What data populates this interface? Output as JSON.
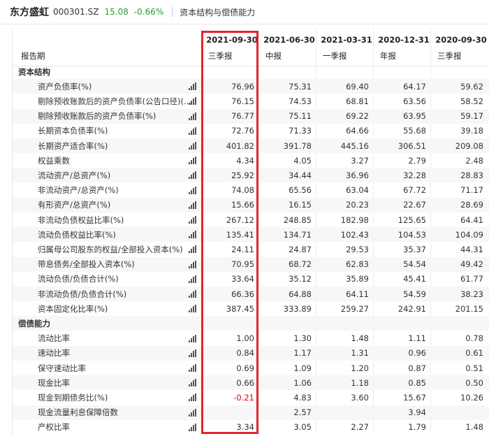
{
  "header": {
    "stock_name": "东方盛虹",
    "stock_code": "000301.SZ",
    "price": "15.08",
    "change": "-0.66%",
    "section": "资本结构与偿债能力"
  },
  "table": {
    "row_header_label": "报告期",
    "columns": [
      {
        "date": "2021-09-30",
        "type": "三季报"
      },
      {
        "date": "2021-06-30",
        "type": "中报"
      },
      {
        "date": "2021-03-31",
        "type": "一季报"
      },
      {
        "date": "2020-12-31",
        "type": "年报"
      },
      {
        "date": "2020-09-30",
        "type": "三季报"
      }
    ],
    "rows": [
      {
        "label": "资本结构",
        "section": true,
        "values": [
          "",
          "",
          "",
          "",
          ""
        ]
      },
      {
        "label": "资产负债率(%)",
        "values": [
          "76.96",
          "75.31",
          "69.40",
          "64.17",
          "59.62"
        ]
      },
      {
        "label": "剔除预收账款后的资产负债率(公告口径)(...",
        "values": [
          "76.15",
          "74.53",
          "68.81",
          "63.56",
          "58.52"
        ]
      },
      {
        "label": "剔除预收账款后的资产负债率(%)",
        "values": [
          "76.77",
          "75.11",
          "69.22",
          "63.95",
          "59.17"
        ]
      },
      {
        "label": "长期资本负债率(%)",
        "values": [
          "72.76",
          "71.33",
          "64.66",
          "55.68",
          "39.18"
        ]
      },
      {
        "label": "长期资产适合率(%)",
        "values": [
          "401.82",
          "391.78",
          "445.16",
          "306.51",
          "209.08"
        ]
      },
      {
        "label": "权益乘数",
        "values": [
          "4.34",
          "4.05",
          "3.27",
          "2.79",
          "2.48"
        ]
      },
      {
        "label": "流动资产/总资产(%)",
        "values": [
          "25.92",
          "34.44",
          "36.96",
          "32.28",
          "28.83"
        ]
      },
      {
        "label": "非流动资产/总资产(%)",
        "values": [
          "74.08",
          "65.56",
          "63.04",
          "67.72",
          "71.17"
        ]
      },
      {
        "label": "有形资产/总资产(%)",
        "values": [
          "15.66",
          "16.15",
          "20.23",
          "22.67",
          "28.69"
        ]
      },
      {
        "label": "非流动负债权益比率(%)",
        "values": [
          "267.12",
          "248.85",
          "182.98",
          "125.65",
          "64.41"
        ]
      },
      {
        "label": "流动负债权益比率(%)",
        "values": [
          "135.41",
          "134.71",
          "102.43",
          "104.53",
          "104.09"
        ]
      },
      {
        "label": "归属母公司股东的权益/全部投入资本(%)",
        "values": [
          "24.11",
          "24.87",
          "29.53",
          "35.37",
          "44.31"
        ]
      },
      {
        "label": "带息债务/全部投入资本(%)",
        "values": [
          "70.95",
          "68.72",
          "62.83",
          "54.54",
          "49.42"
        ]
      },
      {
        "label": "流动负债/负债合计(%)",
        "values": [
          "33.64",
          "35.12",
          "35.89",
          "45.41",
          "61.77"
        ]
      },
      {
        "label": "非流动负债/负债合计(%)",
        "values": [
          "66.36",
          "64.88",
          "64.11",
          "54.59",
          "38.23"
        ]
      },
      {
        "label": "资本固定化比率(%)",
        "values": [
          "387.45",
          "333.89",
          "259.27",
          "242.91",
          "201.15"
        ]
      },
      {
        "label": "偿债能力",
        "section": true,
        "values": [
          "",
          "",
          "",
          "",
          ""
        ]
      },
      {
        "label": "流动比率",
        "values": [
          "1.00",
          "1.30",
          "1.48",
          "1.11",
          "0.78"
        ]
      },
      {
        "label": "速动比率",
        "values": [
          "0.84",
          "1.17",
          "1.31",
          "0.96",
          "0.61"
        ]
      },
      {
        "label": "保守速动比率",
        "values": [
          "0.69",
          "1.09",
          "1.20",
          "0.87",
          "0.51"
        ]
      },
      {
        "label": "现金比率",
        "values": [
          "0.66",
          "1.06",
          "1.18",
          "0.85",
          "0.50"
        ]
      },
      {
        "label": "现金到期债务比(%)",
        "values": [
          "-0.21",
          "4.83",
          "3.60",
          "15.67",
          "10.26"
        ]
      },
      {
        "label": "现金流量利息保障倍数",
        "values": [
          "",
          "2.57",
          "",
          "3.94",
          ""
        ]
      },
      {
        "label": "产权比率",
        "values": [
          "3.34",
          "3.05",
          "2.27",
          "1.79",
          "1.48"
        ]
      }
    ]
  },
  "colors": {
    "highlight_box": "#e8232f",
    "negative": "#e60012",
    "price_down": "#2a9d3a"
  },
  "icons": {
    "row_chart": "bar-chart-icon"
  }
}
